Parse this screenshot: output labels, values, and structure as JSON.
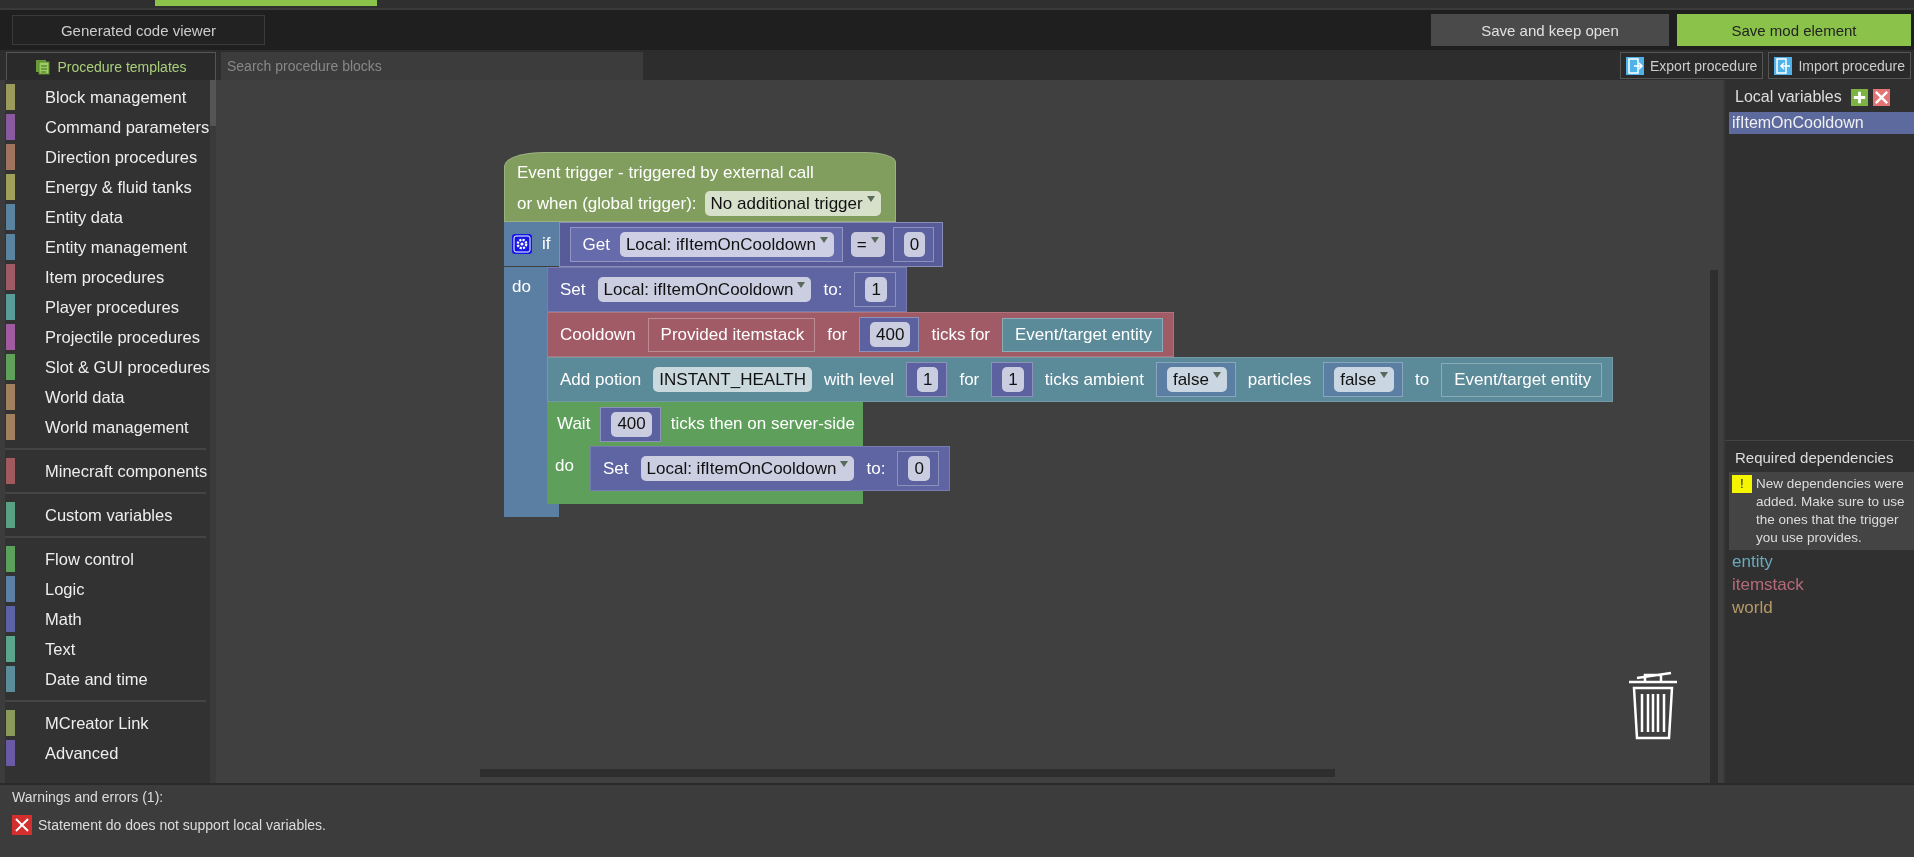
{
  "toolbar": {
    "code_viewer_button": "Generated code viewer",
    "save_open_button": "Save and keep open",
    "save_button": "Save mod element"
  },
  "palette": {
    "tab": "Procedure templates",
    "search": {
      "placeholder": "Search procedure blocks"
    },
    "groups": [
      {
        "items": [
          {
            "label": "Block management",
            "color": "#9a9a5a"
          },
          {
            "label": "Command parameters",
            "color": "#8a5aa0"
          },
          {
            "label": "Direction procedures",
            "color": "#a0735e"
          },
          {
            "label": "Energy & fluid tanks",
            "color": "#a0a05a"
          },
          {
            "label": "Entity data",
            "color": "#5a83a0"
          },
          {
            "label": "Entity management",
            "color": "#5a83a0"
          },
          {
            "label": "Item procedures",
            "color": "#a05a66"
          },
          {
            "label": "Player procedures",
            "color": "#5a9c9a"
          },
          {
            "label": "Projectile procedures",
            "color": "#a05aa0"
          },
          {
            "label": "Slot & GUI procedures",
            "color": "#5fa05a"
          },
          {
            "label": "World data",
            "color": "#a0805e"
          },
          {
            "label": "World management",
            "color": "#a0805e"
          }
        ]
      },
      {
        "items": [
          {
            "label": "Minecraft components",
            "color": "#a05a5e"
          }
        ]
      },
      {
        "items": [
          {
            "label": "Custom variables",
            "color": "#5aa083"
          }
        ]
      },
      {
        "items": [
          {
            "label": "Flow control",
            "color": "#5ba05b"
          },
          {
            "label": "Logic",
            "color": "#5b7fa5"
          },
          {
            "label": "Math",
            "color": "#5b62a5"
          },
          {
            "label": "Text",
            "color": "#5ba58c"
          },
          {
            "label": "Date and time",
            "color": "#5b8c9a"
          }
        ]
      },
      {
        "items": [
          {
            "label": "MCreator Link",
            "color": "#8a9a5a"
          },
          {
            "label": "Advanced",
            "color": "#6a5aa5"
          }
        ]
      }
    ]
  },
  "procedure_buttons": {
    "export": "Export procedure",
    "import": "Import procedure"
  },
  "workspace": {
    "blocks": [
      {
        "kind": "hat",
        "color": "#829e5f",
        "rows": [
          {
            "parts": [
              {
                "kind": "label",
                "text": "Event trigger - triggered by external call"
              }
            ]
          },
          {
            "parts": [
              {
                "kind": "label",
                "text": "or when (global trigger):"
              },
              {
                "kind": "dropdown",
                "text": "No additional trigger"
              }
            ]
          }
        ],
        "next": [
          {
            "kind": "container",
            "color": "#5b7fa3",
            "rows": [
              {
                "parts": [
                  {
                    "kind": "mutator"
                  },
                  {
                    "kind": "label",
                    "text": "if"
                  }
                ],
                "input": {
                  "color": "#575c98",
                  "parts": [
                    {
                      "kind": "block",
                      "block": {
                        "color": "#666bac",
                        "parts": [
                          {
                            "kind": "label",
                            "text": "Get"
                          },
                          {
                            "kind": "dropdown",
                            "text": "Local: ifItemOnCooldown"
                          }
                        ]
                      }
                    },
                    {
                      "kind": "dropdown",
                      "text": "="
                    },
                    {
                      "kind": "block",
                      "block": {
                        "color": "#5c62a0",
                        "parts": [
                          {
                            "kind": "field",
                            "text": "0"
                          }
                        ]
                      }
                    }
                  ]
                }
              },
              {
                "parts": [
                  {
                    "kind": "label",
                    "text": "do"
                  }
                ],
                "statements": [
                  {
                    "kind": "statement",
                    "color": "#5e65a2",
                    "parts": [
                      {
                        "kind": "label",
                        "text": "Set"
                      },
                      {
                        "kind": "dropdown",
                        "text": "Local: ifItemOnCooldown"
                      },
                      {
                        "kind": "label",
                        "text": "to:"
                      },
                      {
                        "kind": "block",
                        "block": {
                          "color": "#5c62a0",
                          "parts": [
                            {
                              "kind": "field",
                              "text": "1"
                            }
                          ]
                        }
                      }
                    ]
                  },
                  {
                    "kind": "statement",
                    "color": "#a05b67",
                    "parts": [
                      {
                        "kind": "label",
                        "text": "Cooldown"
                      },
                      {
                        "kind": "block",
                        "block": {
                          "color": "#a05b67",
                          "parts": [
                            {
                              "kind": "label",
                              "text": "Provided itemstack"
                            }
                          ]
                        }
                      },
                      {
                        "kind": "label",
                        "text": "for"
                      },
                      {
                        "kind": "block",
                        "block": {
                          "color": "#5c62a0",
                          "parts": [
                            {
                              "kind": "field",
                              "text": "400"
                            }
                          ]
                        }
                      },
                      {
                        "kind": "label",
                        "text": "ticks for"
                      },
                      {
                        "kind": "block",
                        "block": {
                          "color": "#5b8a98",
                          "parts": [
                            {
                              "kind": "label",
                              "text": "Event/target entity"
                            }
                          ]
                        }
                      }
                    ]
                  },
                  {
                    "kind": "statement",
                    "color": "#5b8a98",
                    "parts": [
                      {
                        "kind": "label",
                        "text": "Add potion"
                      },
                      {
                        "kind": "field",
                        "text": "INSTANT_HEALTH"
                      },
                      {
                        "kind": "label",
                        "text": "with level"
                      },
                      {
                        "kind": "block",
                        "block": {
                          "color": "#5c62a0",
                          "parts": [
                            {
                              "kind": "field",
                              "text": "1"
                            }
                          ]
                        }
                      },
                      {
                        "kind": "label",
                        "text": "for"
                      },
                      {
                        "kind": "block",
                        "block": {
                          "color": "#5c62a0",
                          "parts": [
                            {
                              "kind": "field",
                              "text": "1"
                            }
                          ]
                        }
                      },
                      {
                        "kind": "label",
                        "text": "ticks ambient"
                      },
                      {
                        "kind": "block",
                        "block": {
                          "color": "#5b7fa3",
                          "parts": [
                            {
                              "kind": "dropdown",
                              "text": "false"
                            }
                          ]
                        }
                      },
                      {
                        "kind": "label",
                        "text": "particles"
                      },
                      {
                        "kind": "block",
                        "block": {
                          "color": "#5b7fa3",
                          "parts": [
                            {
                              "kind": "dropdown",
                              "text": "false"
                            }
                          ]
                        }
                      },
                      {
                        "kind": "label",
                        "text": "to"
                      },
                      {
                        "kind": "block",
                        "block": {
                          "color": "#5b8a98",
                          "parts": [
                            {
                              "kind": "label",
                              "text": "Event/target entity"
                            }
                          ]
                        }
                      }
                    ]
                  },
                  {
                    "kind": "container",
                    "color": "#5ea05b",
                    "rows": [
                      {
                        "parts": [
                          {
                            "kind": "label",
                            "text": "Wait"
                          },
                          {
                            "kind": "block",
                            "block": {
                              "color": "#5c62a0",
                              "parts": [
                                {
                                  "kind": "field",
                                  "text": "400"
                                }
                              ]
                            }
                          },
                          {
                            "kind": "label",
                            "text": "ticks then on server-side"
                          }
                        ]
                      },
                      {
                        "parts": [
                          {
                            "kind": "label",
                            "text": "do"
                          }
                        ],
                        "statements": [
                          {
                            "kind": "statement",
                            "color": "#5e65a2",
                            "parts": [
                              {
                                "kind": "label",
                                "text": "Set"
                              },
                              {
                                "kind": "dropdown",
                                "text": "Local: ifItemOnCooldown"
                              },
                              {
                                "kind": "label",
                                "text": "to:"
                              },
                              {
                                "kind": "block",
                                "block": {
                                  "color": "#5c62a0",
                                  "parts": [
                                    {
                                      "kind": "field",
                                      "text": "0"
                                    }
                                  ]
                                }
                              }
                            ]
                          }
                        ]
                      }
                    ]
                  }
                ]
              }
            ]
          }
        ]
      }
    ]
  },
  "variables": {
    "title": "Local variables",
    "items": [
      {
        "name": "ifItemOnCooldown",
        "selected": true
      }
    ]
  },
  "dependencies": {
    "title": "Required dependencies",
    "warning_glyph": "!",
    "warning": "New dependencies were added. Make sure to use the ones that the trigger you use provides.",
    "items": [
      {
        "name": "entity",
        "color": "#6aaabd"
      },
      {
        "name": "itemstack",
        "color": "#b56a7a"
      },
      {
        "name": "world",
        "color": "#b59a6a"
      }
    ]
  },
  "errors": {
    "title": "Warnings and errors (1):",
    "items": [
      {
        "message": "Statement do does not support local variables."
      }
    ]
  }
}
